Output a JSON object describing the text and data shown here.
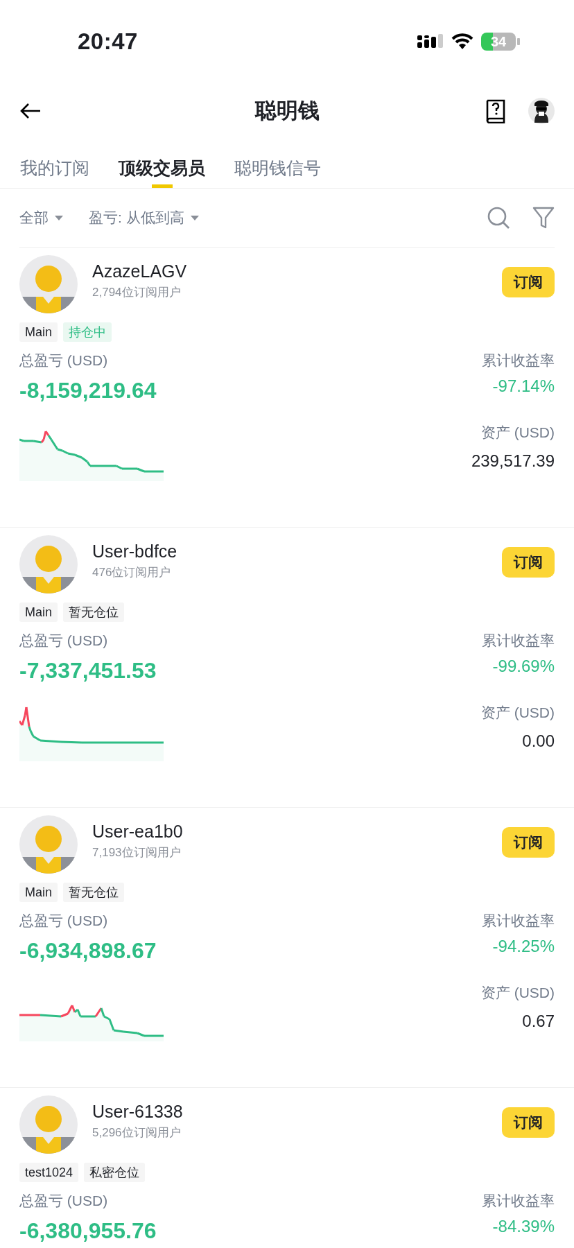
{
  "status_bar": {
    "time": "20:47",
    "battery": "34"
  },
  "header": {
    "title": "聪明钱"
  },
  "tabs": [
    {
      "label": "我的订阅",
      "selected": false
    },
    {
      "label": "顶级交易员",
      "selected": true
    },
    {
      "label": "聪明钱信号",
      "selected": false
    }
  ],
  "filters": [
    {
      "label": "全部"
    },
    {
      "label": "盈亏: 从低到高"
    }
  ],
  "traders": [
    {
      "name": "AzazeLAGV",
      "subscribers": "2,794位订阅用户",
      "button": "订阅",
      "tags": [
        {
          "label": "Main",
          "kind": "plain"
        },
        {
          "label": "持仓中",
          "kind": "holding"
        }
      ],
      "pnl_label": "总盈亏 (USD)",
      "pnl": "-8,159,219.64",
      "roi_label": "累计收益率",
      "roi": "-97.14%",
      "assets_label": "资产 (USD)",
      "assets": "239,517.39",
      "chart": {
        "kind": "picture"
      }
    },
    {
      "name": "User-bdfce",
      "subscribers": "476位订阅用户",
      "button": "订阅",
      "tags": [
        {
          "label": "Main",
          "kind": "plain"
        },
        {
          "label": "暂无仓位",
          "kind": "plain"
        }
      ],
      "pnl_label": "总盈亏 (USD)",
      "pnl": "-7,337,451.53",
      "roi_label": "累计收益率",
      "roi": "-99.69%",
      "assets_label": "资产 (USD)",
      "assets": "0.00",
      "chart": {
        "kind": "picture"
      }
    },
    {
      "name": "User-ea1b0",
      "subscribers": "7,193位订阅用户",
      "button": "订阅",
      "tags": [
        {
          "label": "Main",
          "kind": "plain"
        },
        {
          "label": "暂无仓位",
          "kind": "plain"
        }
      ],
      "pnl_label": "总盈亏 (USD)",
      "pnl": "-6,934,898.67",
      "roi_label": "累计收益率",
      "roi": "-94.25%",
      "assets_label": "资产 (USD)",
      "assets": "0.67",
      "chart": {
        "kind": "picture"
      }
    },
    {
      "name": "User-61338",
      "subscribers": "5,296位订阅用户",
      "button": "订阅",
      "tags": [
        {
          "label": "test1024",
          "kind": "plain"
        },
        {
          "label": "私密仓位",
          "kind": "plain"
        }
      ],
      "pnl_label": "总盈亏 (USD)",
      "pnl": "-6,380,955.76",
      "roi_label": "累计收益率",
      "roi": "-84.39%"
    }
  ]
}
